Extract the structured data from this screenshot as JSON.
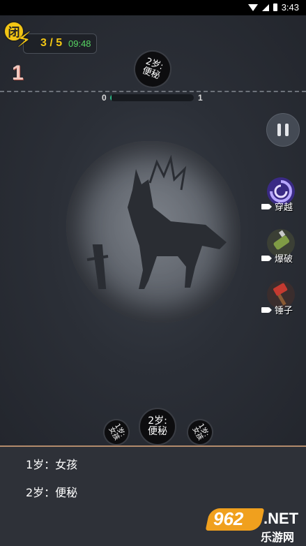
{
  "status_bar": {
    "time": "3:43"
  },
  "hud": {
    "close_label": "闭",
    "energy_count": "3 / 5",
    "energy_timer": "09:48",
    "level": "1"
  },
  "target": {
    "line1": "2岁:",
    "line2": "便秘"
  },
  "progress": {
    "min": "0",
    "max": "1",
    "fraction": 0.0
  },
  "tools": [
    {
      "name": "crossing",
      "label": "穿越",
      "icon": "vortex-icon",
      "color": "#5a3fb8"
    },
    {
      "name": "blast",
      "label": "爆破",
      "icon": "grenade-icon",
      "color": "#6f8a3a"
    },
    {
      "name": "hammer",
      "label": "锤子",
      "icon": "hammer-icon",
      "color": "#b5322b"
    }
  ],
  "bubbles": {
    "left": {
      "line1": "1岁:",
      "line2": "女孩"
    },
    "center": {
      "line1": "2岁:",
      "line2": "便秘"
    },
    "right": {
      "line1": "1岁:",
      "line2": "女孩"
    }
  },
  "answers": [
    {
      "text": "1岁：女孩"
    },
    {
      "text": "2岁：便秘"
    }
  ],
  "watermark": {
    "number": "962",
    "suffix": ".NET",
    "subtitle": "乐游网"
  }
}
